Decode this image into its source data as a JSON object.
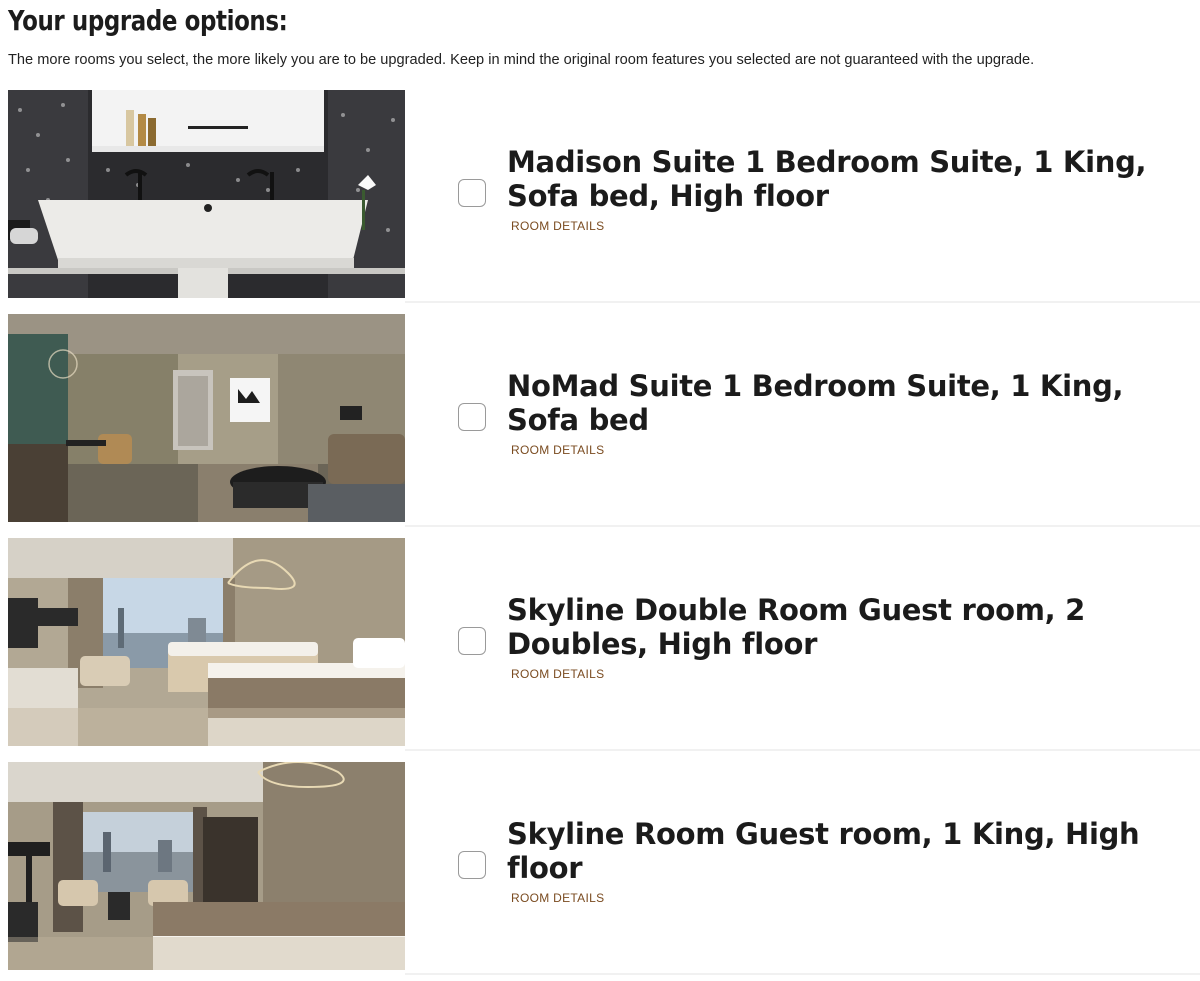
{
  "page": {
    "title": "Your upgrade options:",
    "intro": "The more rooms you select, the more likely you are to be upgraded. Keep in mind the original room features you selected are not guaranteed with the upgrade."
  },
  "rooms": [
    {
      "name": "Madison Suite 1 Bedroom Suite, 1 King, Sofa bed, High floor",
      "details_label": "ROOM DETAILS",
      "photo": "bathroom-double-sink-photo",
      "checked": false
    },
    {
      "name": "NoMad Suite 1 Bedroom Suite, 1 King, Sofa bed",
      "details_label": "ROOM DETAILS",
      "photo": "suite-living-room-photo",
      "checked": false
    },
    {
      "name": "Skyline Double Room Guest room, 2 Doubles, High floor",
      "details_label": "ROOM DETAILS",
      "photo": "two-beds-city-view-photo",
      "checked": false
    },
    {
      "name": "Skyline Room Guest room, 1 King, High floor",
      "details_label": "ROOM DETAILS",
      "photo": "king-bed-city-view-photo",
      "checked": false
    }
  ],
  "colors": {
    "link": "#7a4b20",
    "checkbox_border": "#9a9a9a",
    "divider": "#f1f1f1"
  }
}
